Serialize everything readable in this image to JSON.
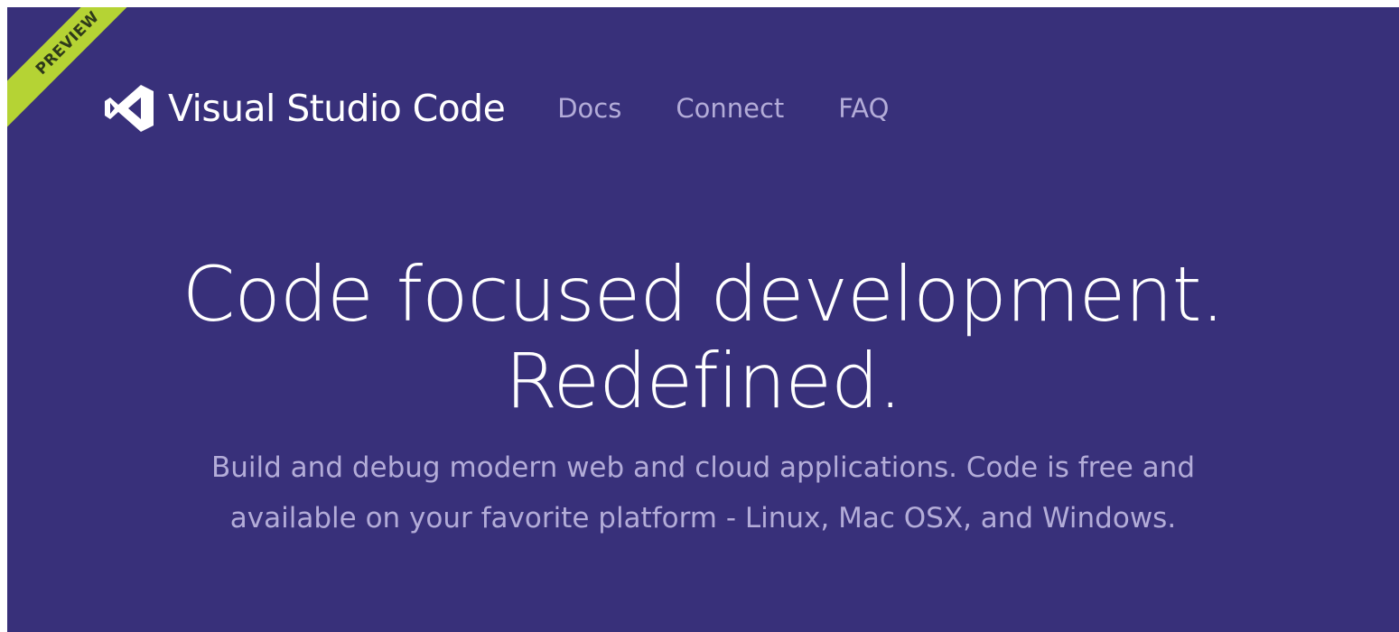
{
  "ribbon": {
    "label": "PREVIEW"
  },
  "header": {
    "brand": "Visual Studio Code",
    "nav": [
      {
        "label": "Docs"
      },
      {
        "label": "Connect"
      },
      {
        "label": "FAQ"
      }
    ]
  },
  "hero": {
    "title_line1": "Code focused development.",
    "title_line2": "Redefined.",
    "subtitle": "Build and debug modern web and cloud applications. Code is free and available on your favorite platform - Linux, Mac OSX, and Windows."
  },
  "icons": {
    "logo": "visual-studio-code-logo-icon"
  },
  "colors": {
    "background": "#38307a",
    "ribbon": "#b5d334",
    "nav_text": "#b3acd8",
    "title_text": "#ffffff"
  }
}
